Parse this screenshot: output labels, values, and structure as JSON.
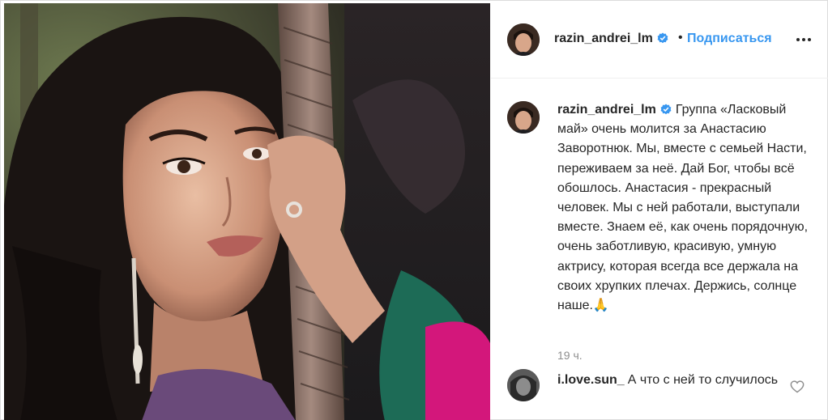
{
  "post": {
    "image_alt": "portrait photo",
    "author": {
      "username": "razin_andrei_lm",
      "verified_icon": "verified-badge-icon"
    },
    "header": {
      "separator": "•",
      "follow_label": "Подписаться",
      "more_icon": "more-options-icon"
    },
    "caption": {
      "username": "razin_andrei_lm",
      "text": "Группа «Ласковый май» очень молится за Анастасию Заворотнюк. Мы, вместе с семьей Насти, переживаем за неё. Дай Бог, чтобы всё обошлось. Анастасия - прекрасный человек. Мы с ней работали, выступали вместе. Знаем её, как очень порядочную, очень заботливую, красивую, умную актрису, которая всегда все держала на своих хрупких плечах. Держись, солнце наше.🙏"
    },
    "timestamp": "19 ч.",
    "comments": [
      {
        "username": "i.love.sun_",
        "text": "А что с ней то случилось",
        "like_icon": "heart-icon"
      }
    ]
  },
  "colors": {
    "accent": "#3897f0",
    "text": "#262626",
    "muted": "#8e8e8e",
    "border": "#dbdbdb"
  }
}
